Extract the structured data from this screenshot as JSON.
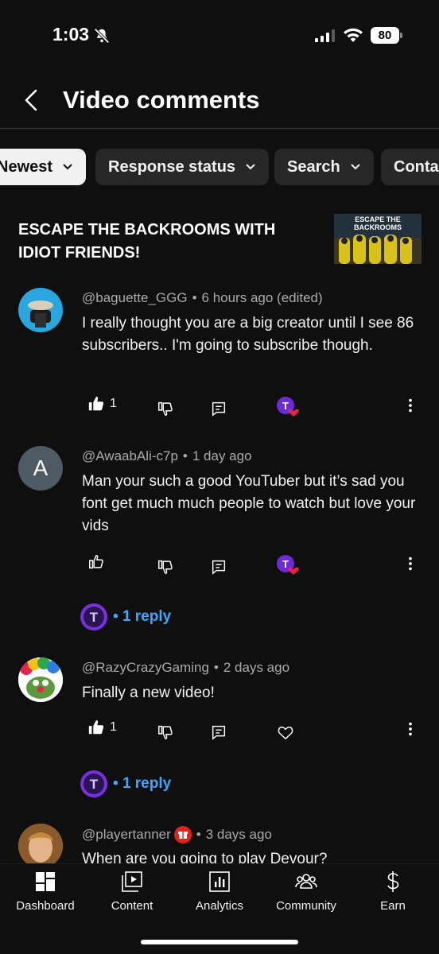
{
  "status_bar": {
    "time": "1:03",
    "battery": "80"
  },
  "header": {
    "title": "Video comments"
  },
  "filters": [
    {
      "label": "Newest",
      "active": true
    },
    {
      "label": "Response status",
      "active": false
    },
    {
      "label": "Search",
      "active": false
    },
    {
      "label": "Conta",
      "active": false
    }
  ],
  "video": {
    "title": "ESCAPE THE BACKROOMS WITH IDIOT FRIENDS!",
    "thumbnail_text": "ESCAPE THE BACKROOMS"
  },
  "comments": [
    {
      "author": "@baguette_GGG",
      "time": "6 hours ago (edited)",
      "text": "I really thought you are a big creator until I see 86 subscribers.. I'm going to subscribe though.",
      "likes": "1",
      "avatar_letter": "",
      "hearted": true
    },
    {
      "author": "@AwaabAli-c7p",
      "time": "1 day ago",
      "text": "Man your such a good YouTuber but it’s sad you font get much much people to watch but love your vids",
      "likes": "",
      "avatar_letter": "A",
      "hearted": true,
      "replies": "1 reply"
    },
    {
      "author": "@RazyCrazyGaming",
      "time": "2 days ago",
      "text": "Finally a new video!",
      "likes": "1",
      "avatar_letter": "",
      "hearted": false,
      "replies": "1 reply"
    },
    {
      "author": "@playertanner",
      "time": "3 days ago",
      "text": "When are you going to play Devour?",
      "likes": "",
      "avatar_letter": "",
      "hearted": false
    }
  ],
  "nav": [
    {
      "label": "Dashboard",
      "icon": "dashboard-icon"
    },
    {
      "label": "Content",
      "icon": "content-icon"
    },
    {
      "label": "Analytics",
      "icon": "analytics-icon"
    },
    {
      "label": "Community",
      "icon": "community-icon"
    },
    {
      "label": "Earn",
      "icon": "earn-icon"
    }
  ],
  "colors": {
    "background": "#0f0f0f",
    "chip": "#272727",
    "link": "#3ea6ff",
    "heart": "#e8234b"
  }
}
